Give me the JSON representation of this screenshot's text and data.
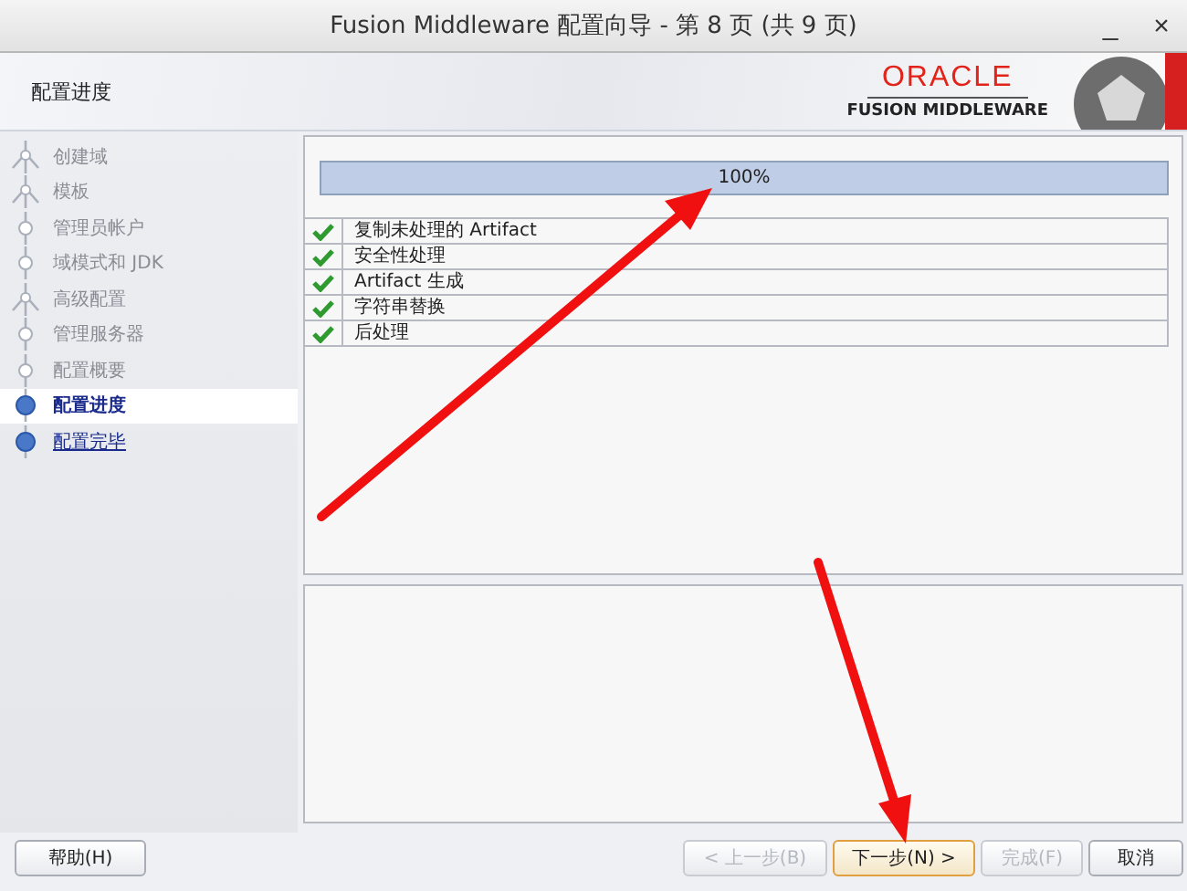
{
  "window": {
    "title": "Fusion Middleware 配置向导 - 第 8 页 (共 9 页)",
    "minimize": "_",
    "close": "×"
  },
  "header": {
    "title": "配置进度",
    "brand": "ORACLE",
    "product": "FUSION MIDDLEWARE"
  },
  "steps": [
    {
      "label": "创建域",
      "kind": "branch",
      "done": true,
      "selected": false
    },
    {
      "label": "模板",
      "kind": "branch",
      "done": true,
      "selected": false
    },
    {
      "label": "管理员帐户",
      "kind": "step",
      "done": true,
      "selected": false
    },
    {
      "label": "域模式和 JDK",
      "kind": "step",
      "done": true,
      "selected": false
    },
    {
      "label": "高级配置",
      "kind": "branch",
      "done": true,
      "selected": false
    },
    {
      "label": "管理服务器",
      "kind": "step",
      "done": true,
      "selected": false
    },
    {
      "label": "配置概要",
      "kind": "step",
      "done": true,
      "selected": false
    },
    {
      "label": "配置进度",
      "kind": "step",
      "done": false,
      "selected": true
    },
    {
      "label": "配置完毕",
      "kind": "step",
      "done": false,
      "selected": false
    }
  ],
  "progress": {
    "level": 1,
    "reading": "100%"
  },
  "tasks": [
    {
      "label": "复制未处理的 Artifact",
      "done": true
    },
    {
      "label": "安全性处理",
      "done": true
    },
    {
      "label": "Artifact 生成",
      "done": true
    },
    {
      "label": "字符串替换",
      "done": true
    },
    {
      "label": "后处理",
      "done": true
    }
  ],
  "buttons": {
    "help": {
      "label": "帮助(H)",
      "disabled": false
    },
    "nav": [
      {
        "label": "< 上一步(B)",
        "disabled": true,
        "focused": false
      },
      {
        "label": "下一步(N) >",
        "disabled": false,
        "focused": true
      },
      {
        "label": "完成(F)",
        "disabled": true,
        "focused": false
      },
      {
        "label": "取消",
        "disabled": false,
        "focused": false
      }
    ]
  }
}
